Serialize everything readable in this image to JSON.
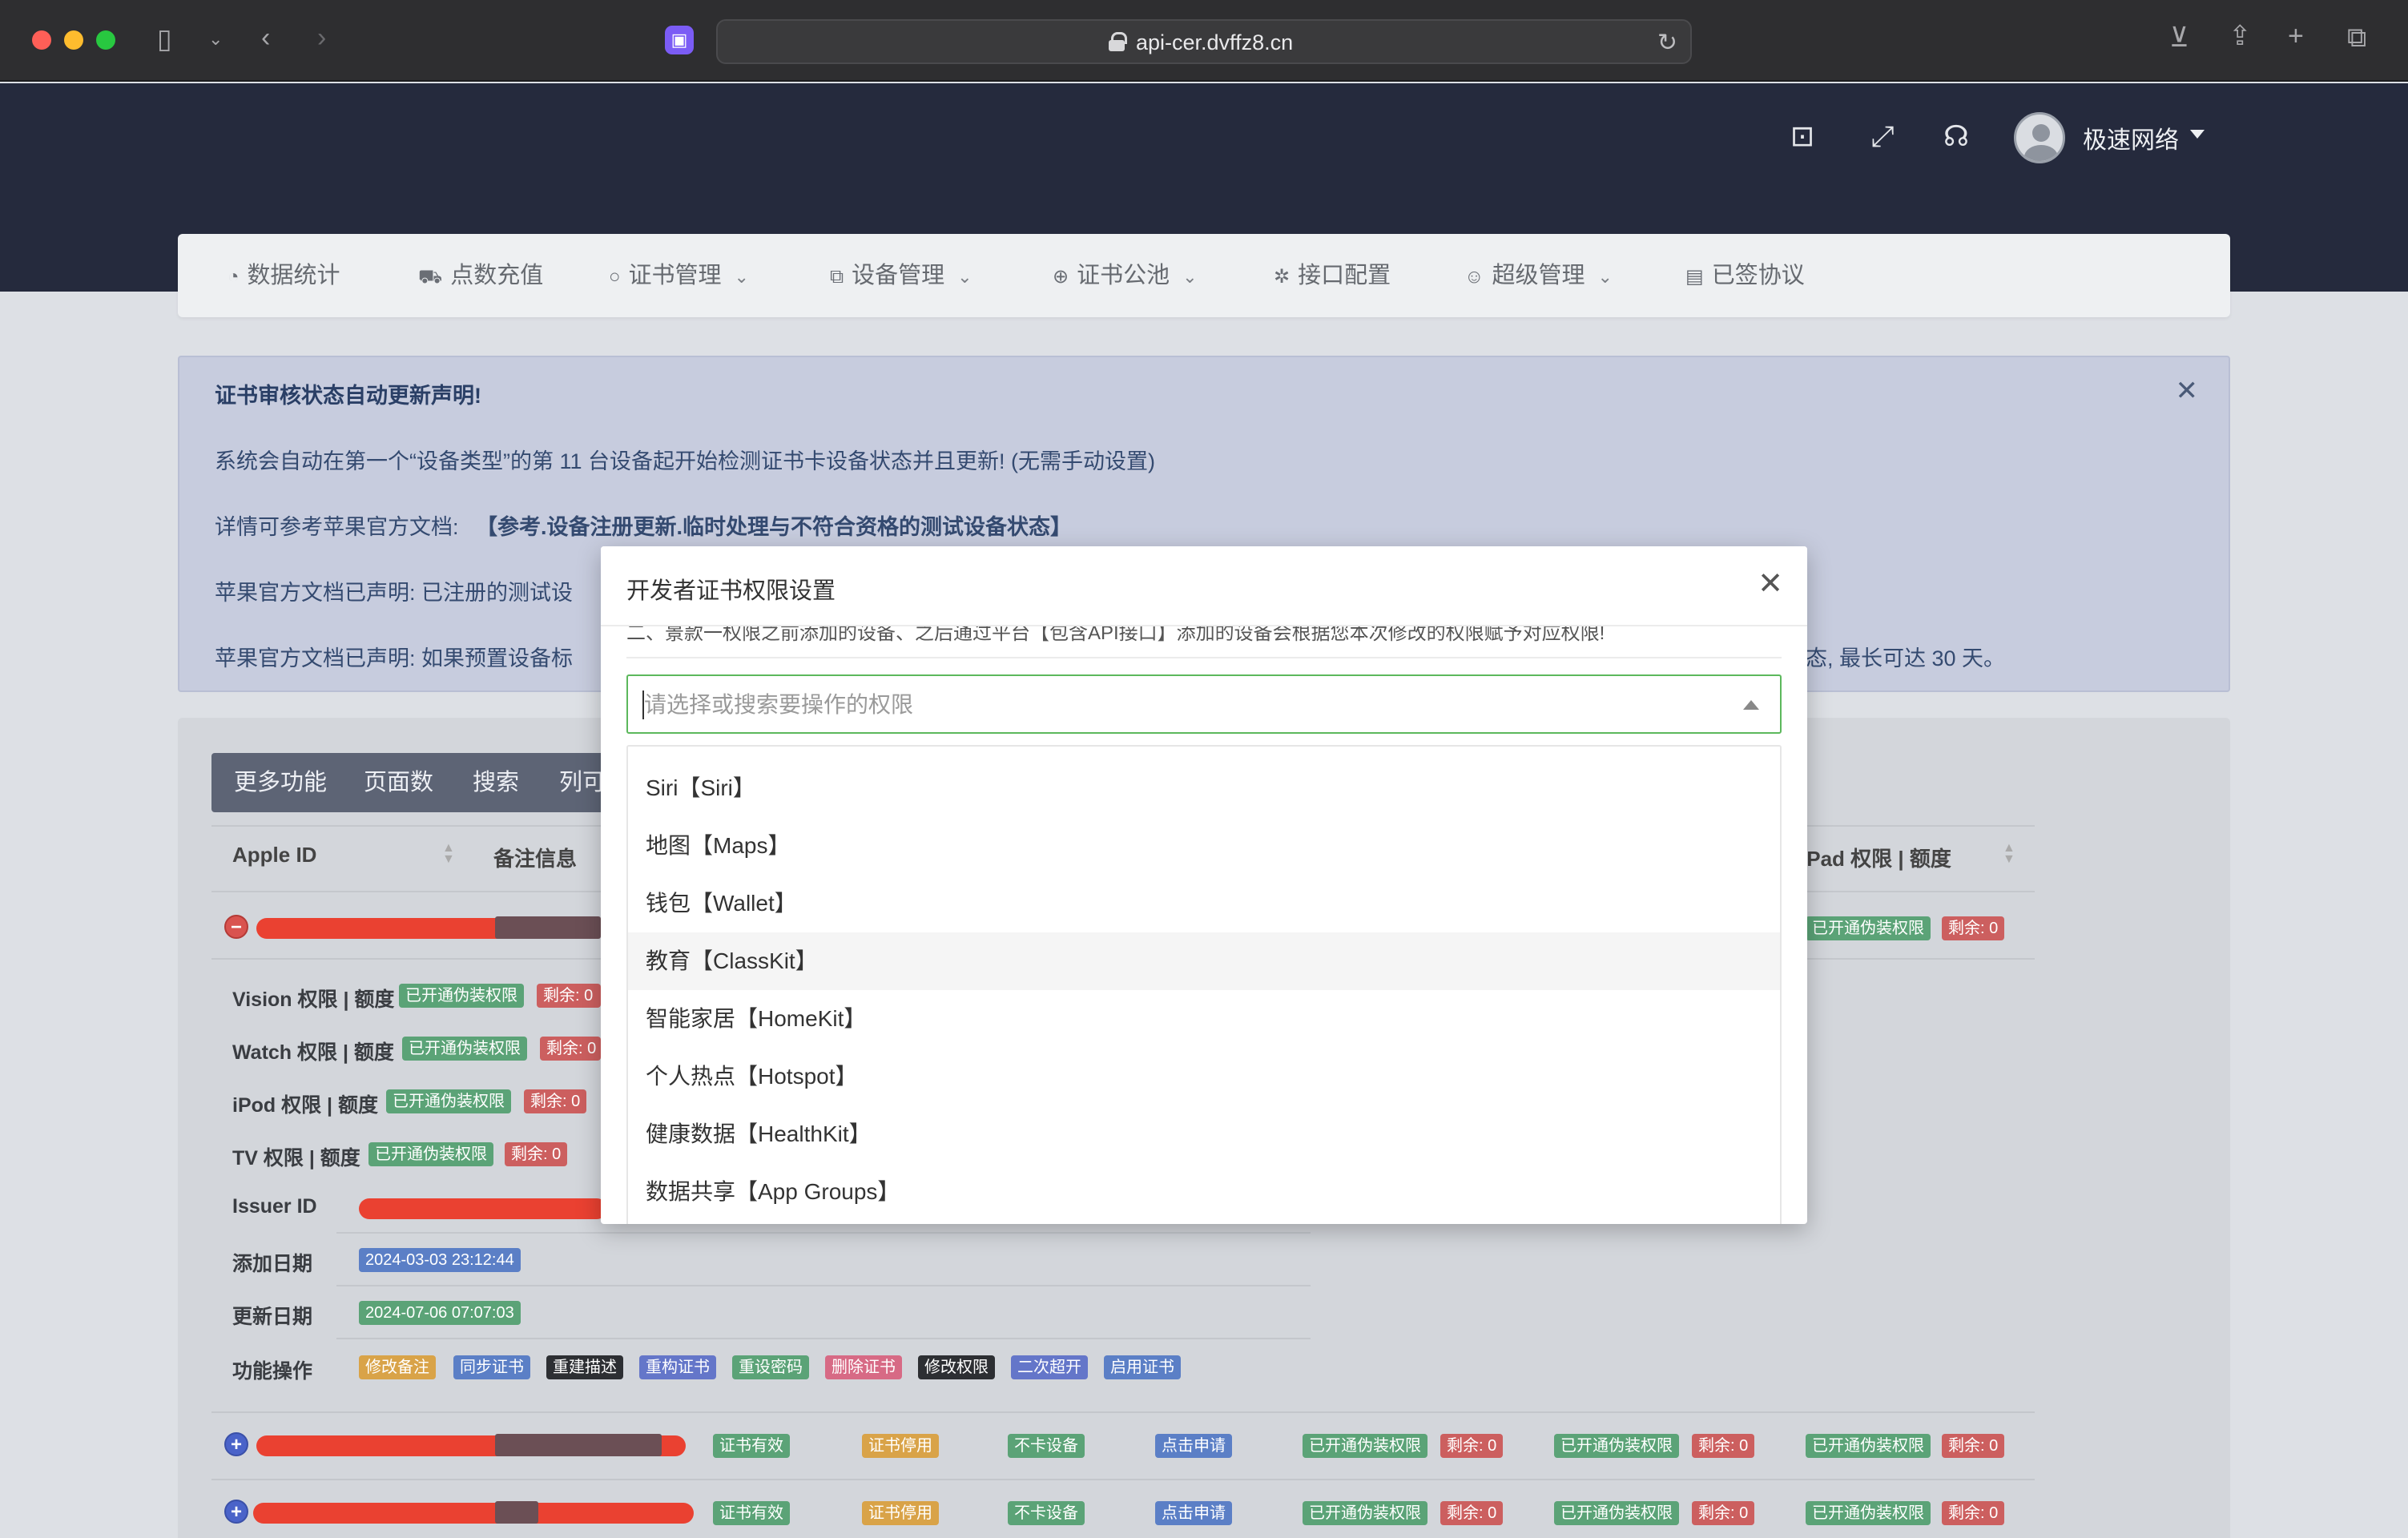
{
  "browser": {
    "url": "api-cer.dvffz8.cn"
  },
  "header": {
    "username": "极速网络"
  },
  "nav": [
    {
      "label": "数据统计",
      "dropdown": false
    },
    {
      "label": "点数充值",
      "dropdown": false
    },
    {
      "label": "证书管理",
      "dropdown": true
    },
    {
      "label": "设备管理",
      "dropdown": true
    },
    {
      "label": "证书公池",
      "dropdown": true
    },
    {
      "label": "接口配置",
      "dropdown": false
    },
    {
      "label": "超级管理",
      "dropdown": true
    },
    {
      "label": "已签协议",
      "dropdown": false
    }
  ],
  "notice": {
    "title": "证书审核状态自动更新声明!",
    "line1": "系统会自动在第一个“设备类型”的第 11 台设备起开始检测证书卡设备状态并且更新! (无需手动设置)",
    "line2_prefix": "详情可参考苹果官方文档:",
    "line2_link": "【参考.设备注册更新.临时处理与不符合资格的测试设备状态】",
    "line3": "苹果官方文档已声明: 已注册的测试设",
    "line4_prefix": "苹果官方文档已声明: 如果预置设备标",
    "line4_suffix": "态, 最长可达 30 天。"
  },
  "toolbar": {
    "more": "更多功能",
    "pages": "页面数",
    "search": "搜索",
    "columns": "列可"
  },
  "table": {
    "col_apple_id": "Apple ID",
    "col_remark": "备注信息",
    "col_ipad": "iPad 权限 | 额度"
  },
  "details": {
    "vision_label": "Vision 权限 | 额度",
    "watch_label": "Watch 权限 | 额度",
    "ipod_label": "iPod 权限 | 额度",
    "tv_label": "TV 权限 | 额度",
    "issuer_label": "Issuer ID",
    "added_label": "添加日期",
    "added_value": "2024-03-03 23:12:44",
    "updated_label": "更新日期",
    "updated_value": "2024-07-06 07:07:03",
    "ops_label": "功能操作",
    "ops": [
      "修改备注",
      "同步证书",
      "重建描述",
      "重构证书",
      "重设密码",
      "删除证书",
      "修改权限",
      "二次超开",
      "启用证书"
    ]
  },
  "tags": {
    "disguise": "已开通伪装权限",
    "remain": "剩余: 0",
    "valid": "证书有效",
    "disabled": "证书停用",
    "no_block": "不卡设备",
    "apply": "点击申请"
  },
  "modal": {
    "title": "开发者证书权限设置",
    "note": "二、景款一权限之前添加的设备、之后通过平台【包含API接口】添加的设备会根据您本次修改的权限赋予对应权限!",
    "placeholder": "请选择或搜索要操作的权限",
    "options": [
      "Siri【Siri】",
      "地图【Maps】",
      "钱包【Wallet】",
      "教育【ClassKit】",
      "智能家居【HomeKit】",
      "个人热点【Hotspot】",
      "健康数据【HealthKit】",
      "数据共享【App Groups】"
    ],
    "highlighted_index": 3
  },
  "icons": {
    "sidebar": "sidebar-icon",
    "back": "back-arrow-icon",
    "forward": "forward-arrow-icon",
    "download": "download-icon",
    "share": "share-icon",
    "new_tab": "plus-icon",
    "tabs": "tabs-icon",
    "archive": "archive-icon",
    "fullscreen": "fullscreen-icon",
    "headset": "headset-icon"
  },
  "colors": {
    "header_bg": "#252a3d",
    "alert_text": "#344a70",
    "select_border": "#5cb85c",
    "tag_green": "#5ba377",
    "tag_red": "#cc5f5f",
    "tag_blue": "#5b7fc6",
    "redaction": "#ea4131"
  }
}
